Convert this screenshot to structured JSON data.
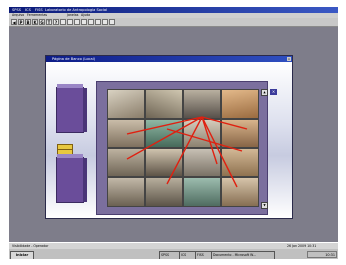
{
  "app": {
    "title_segments": [
      "SPSS",
      "ICS",
      "FISS",
      "Laboratorio de Antropologia Social"
    ]
  },
  "menu": [
    "Arquivo",
    "Ferramentas",
    "Janelas",
    "Ajuda"
  ],
  "toolbar": {
    "buttons": [
      "◀",
      "P",
      "B",
      "K",
      "G",
      "T",
      "?",
      "",
      "",
      "",
      "",
      "",
      "",
      "",
      ""
    ]
  },
  "window": {
    "title": "Página de Banco (Local)",
    "close_label": "×",
    "panel_close_label": "×",
    "scroll_up": "▲",
    "scroll_down": "▼"
  },
  "status": {
    "left": "Visibilidade - Operador",
    "right": "26 Jan 2009  10:31"
  },
  "taskbar": {
    "start_label": "Iniciar",
    "tasks": [
      "SPSS",
      "ICS",
      "FISS",
      "Documento - Microsoft W..."
    ],
    "clock": "10:31"
  },
  "colors": {
    "title_gradient_start": "#0b1a78",
    "workspace": "#7e7d8a",
    "panel": "#7b6f9e",
    "box": "#6a4d9a",
    "arrows": "#e02010"
  }
}
